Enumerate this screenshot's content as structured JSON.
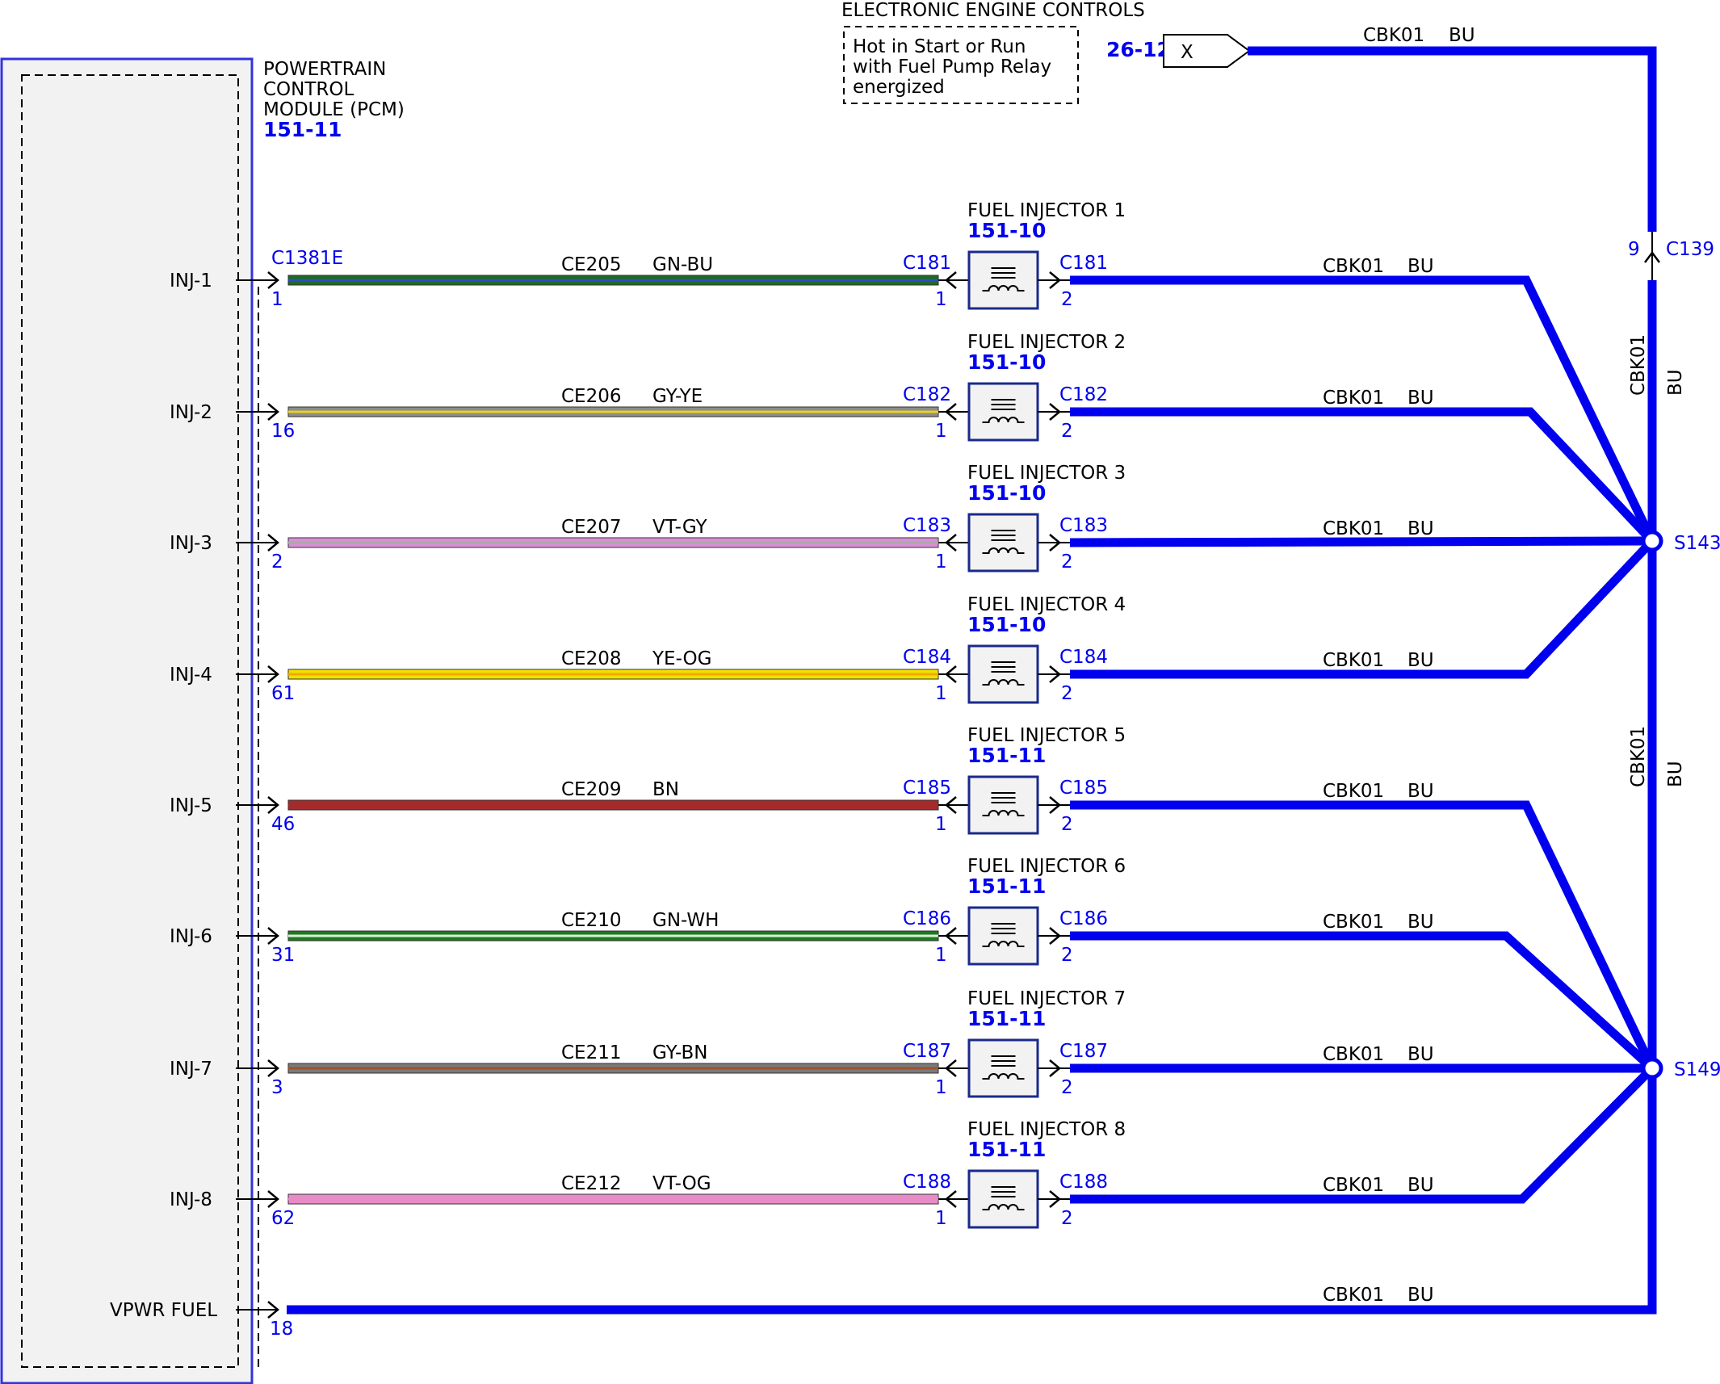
{
  "title": "ELECTRONIC ENGINE CONTROLS",
  "note": {
    "lines": [
      "Hot in Start or Run",
      "with Fuel Pump Relay",
      "energized"
    ]
  },
  "pcm": {
    "name_lines": [
      "POWERTRAIN",
      "CONTROL",
      "MODULE (PCM)"
    ],
    "ref": "151-11",
    "connector": "C1381E"
  },
  "source": {
    "ref": "26-12",
    "symbol": "X",
    "circuit": "CBK01",
    "color": "BU"
  },
  "inline_connector": {
    "id": "C139",
    "pin": "9"
  },
  "splices": [
    {
      "id": "S143"
    },
    {
      "id": "S149"
    }
  ],
  "riser_labels": [
    {
      "circuit": "CBK01",
      "color": "BU"
    },
    {
      "circuit": "CBK01",
      "color": "BU"
    }
  ],
  "injectors": [
    {
      "pcm_label": "INJ-1",
      "pcm_pin": "1",
      "circuit": "CE205",
      "wire_color": "GN-BU",
      "name": "FUEL INJECTOR 1",
      "ref": "151-10",
      "connector": "C181",
      "pin_in": "1",
      "pin_out": "2",
      "out_circuit": "CBK01",
      "out_color": "BU",
      "stripe_main": "#1f6b1f",
      "stripe_trace": "#2a4fc0"
    },
    {
      "pcm_label": "INJ-2",
      "pcm_pin": "16",
      "circuit": "CE206",
      "wire_color": "GY-YE",
      "name": "FUEL INJECTOR 2",
      "ref": "151-10",
      "connector": "C182",
      "pin_in": "1",
      "pin_out": "2",
      "out_circuit": "CBK01",
      "out_color": "BU",
      "stripe_main": "#8c8c8c",
      "stripe_trace": "#e8d020"
    },
    {
      "pcm_label": "INJ-3",
      "pcm_pin": "2",
      "circuit": "CE207",
      "wire_color": "VT-GY",
      "name": "FUEL INJECTOR 3",
      "ref": "151-10",
      "connector": "C183",
      "pin_in": "1",
      "pin_out": "2",
      "out_circuit": "CBK01",
      "out_color": "BU",
      "stripe_main": "#d98fd6",
      "stripe_trace": "#aaaaaa"
    },
    {
      "pcm_label": "INJ-4",
      "pcm_pin": "61",
      "circuit": "CE208",
      "wire_color": "YE-OG",
      "name": "FUEL INJECTOR 4",
      "ref": "151-10",
      "connector": "C184",
      "pin_in": "1",
      "pin_out": "2",
      "out_circuit": "CBK01",
      "out_color": "BU",
      "stripe_main": "#f2e000",
      "stripe_trace": "#f2a900"
    },
    {
      "pcm_label": "INJ-5",
      "pcm_pin": "46",
      "circuit": "CE209",
      "wire_color": "BN",
      "name": "FUEL INJECTOR 5",
      "ref": "151-11",
      "connector": "C185",
      "pin_in": "1",
      "pin_out": "2",
      "out_circuit": "CBK01",
      "out_color": "BU",
      "stripe_main": "#a52a2a",
      "stripe_trace": "#a52a2a"
    },
    {
      "pcm_label": "INJ-6",
      "pcm_pin": "31",
      "circuit": "CE210",
      "wire_color": "GN-WH",
      "name": "FUEL INJECTOR 6",
      "ref": "151-11",
      "connector": "C186",
      "pin_in": "1",
      "pin_out": "2",
      "out_circuit": "CBK01",
      "out_color": "BU",
      "stripe_main": "#1f7a1f",
      "stripe_trace": "#d8f0d8"
    },
    {
      "pcm_label": "INJ-7",
      "pcm_pin": "3",
      "circuit": "CE211",
      "wire_color": "GY-BN",
      "name": "FUEL INJECTOR 7",
      "ref": "151-11",
      "connector": "C187",
      "pin_in": "1",
      "pin_out": "2",
      "out_circuit": "CBK01",
      "out_color": "BU",
      "stripe_main": "#7a7a7a",
      "stripe_trace": "#a0522d"
    },
    {
      "pcm_label": "INJ-8",
      "pcm_pin": "62",
      "circuit": "CE212",
      "wire_color": "VT-OG",
      "name": "FUEL INJECTOR 8",
      "ref": "151-11",
      "connector": "C188",
      "pin_in": "1",
      "pin_out": "2",
      "out_circuit": "CBK01",
      "out_color": "BU",
      "stripe_main": "#e88cc8",
      "stripe_trace": "#e88cc8"
    }
  ],
  "vpwr": {
    "pcm_label": "VPWR FUEL",
    "pcm_pin": "18",
    "circuit": "CBK01",
    "color": "BU"
  },
  "colors": {
    "blue_wire": "#0000ee",
    "link_blue": "#0000ee",
    "module_fill": "#f2f2f2",
    "module_border": "#3333dd"
  }
}
